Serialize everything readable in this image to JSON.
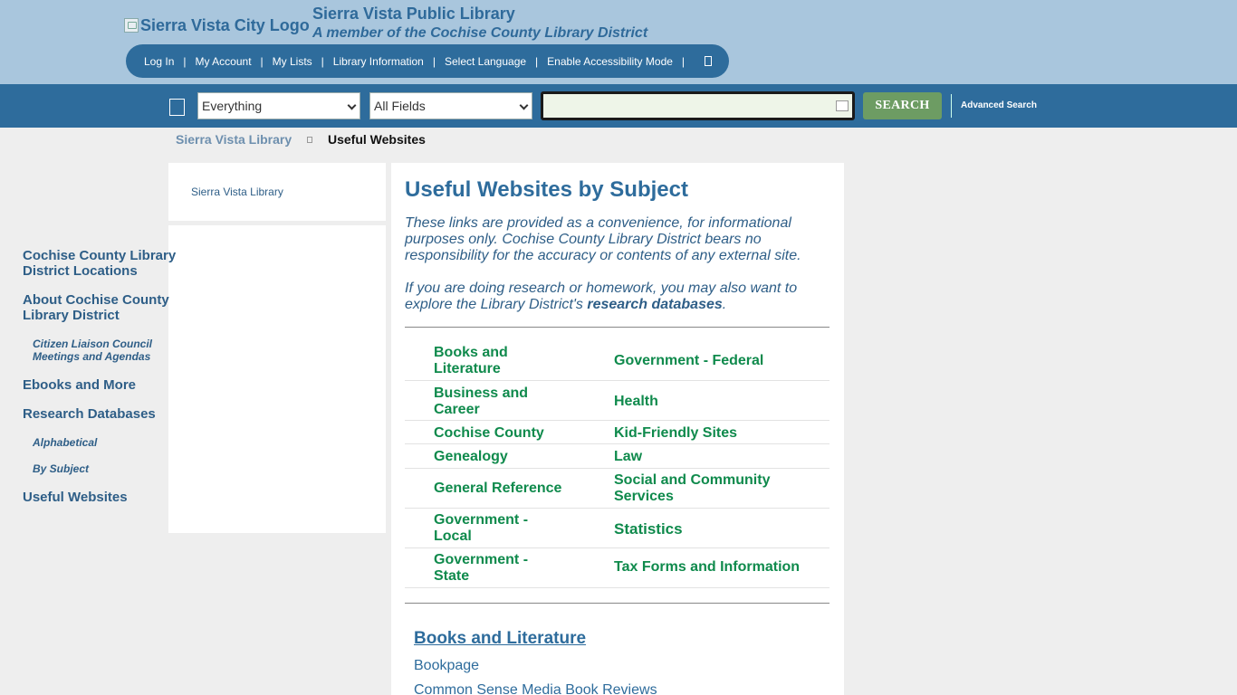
{
  "header": {
    "logo_alt": "Sierra Vista City Logo",
    "title": "Sierra Vista Public Library",
    "subtitle": "A member of the Cochise County Library District"
  },
  "utility_nav": {
    "items": [
      "Log In",
      "My Account",
      "My Lists",
      "Library Information",
      "Select Language",
      "Enable Accessibility Mode"
    ],
    "separator": "|"
  },
  "search": {
    "scope_value": "Everything",
    "field_value": "All Fields",
    "query": "",
    "button_label": "SEARCH",
    "advanced_label": "Advanced Search"
  },
  "breadcrumb": {
    "parent": "Sierra Vista Library",
    "current": "Useful Websites"
  },
  "sidebar": {
    "top_link": "Sierra Vista Library",
    "items": [
      "Cochise County Library District Locations",
      "About Cochise County Library District",
      "Citizen Liaison Council Meetings and Agendas",
      "Ebooks and More",
      "Research Databases",
      "Alphabetical",
      "By Subject",
      "Useful Websites"
    ]
  },
  "main": {
    "heading": "Useful Websites by Subject",
    "disclaimer": "These links are provided as a convenience, for informational purposes only. Cochise County Library District bears no responsibility for the accuracy or contents of any external site.",
    "research_prefix": "If you are doing research or homework, you may also want to explore the Library District's ",
    "research_link": "research databases",
    "research_suffix": ".",
    "subjects_left": [
      "Books and Literature",
      "Business and Career",
      "Cochise County",
      "Genealogy",
      "General Reference",
      "Government - Local",
      "Government - State"
    ],
    "subjects_right": [
      "Government - Federal",
      "Health",
      "Kid-Friendly Sites",
      "Law",
      "Social and Community Services",
      "Statistics",
      "Tax Forms and Information"
    ],
    "section_title": "Books and Literature",
    "section_links": [
      "Bookpage",
      "Common Sense Media Book Reviews"
    ]
  },
  "colors": {
    "header_bg": "#a9c6dd",
    "nav_blue": "#2e6c9c",
    "subject_green": "#0f8a4c",
    "search_button": "#6d9c63"
  }
}
